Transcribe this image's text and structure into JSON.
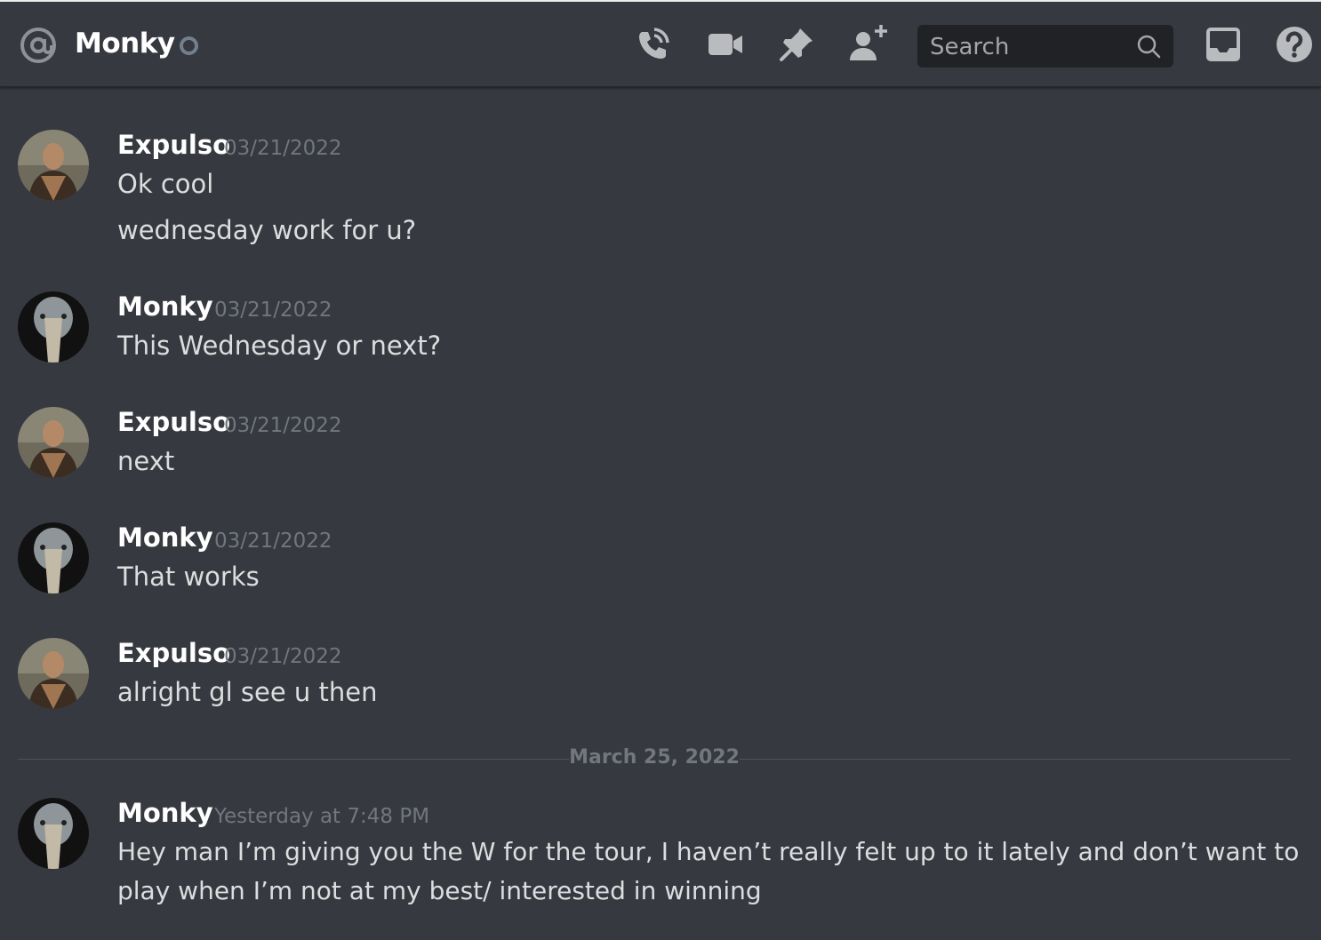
{
  "header": {
    "channel_name": "Monky",
    "search_placeholder": "Search",
    "icons": [
      "at-icon",
      "call-icon",
      "video-icon",
      "pin-icon",
      "add-friend-icon",
      "search-icon",
      "inbox-icon",
      "help-icon"
    ]
  },
  "colors": {
    "background": "#36393f",
    "search_bg": "#202225",
    "username": "#ffffff",
    "text": "#dcddde",
    "timestamp": "#72767d",
    "status_offline": "#747f8d"
  },
  "messages": [
    {
      "author": "Expulso",
      "timestamp": "03/21/2022",
      "lines": [
        "Ok cool",
        "wednesday work for u?"
      ]
    },
    {
      "author": "Monky",
      "timestamp": "03/21/2022",
      "lines": [
        "This Wednesday or next?"
      ]
    },
    {
      "author": "Expulso",
      "timestamp": "03/21/2022",
      "lines": [
        "next"
      ]
    },
    {
      "author": "Monky",
      "timestamp": "03/21/2022",
      "lines": [
        "That works"
      ]
    },
    {
      "author": "Expulso",
      "timestamp": "03/21/2022",
      "lines": [
        "alright gl see u then"
      ]
    },
    {
      "author": "Monky",
      "timestamp": "Yesterday at 7:48 PM",
      "lines": [
        "Hey man I’m giving you the W for the tour, I haven’t really felt up to it lately and don’t want to",
        "play when I’m not at my best/ interested in winning"
      ]
    }
  ],
  "date_divider": "March 25, 2022"
}
